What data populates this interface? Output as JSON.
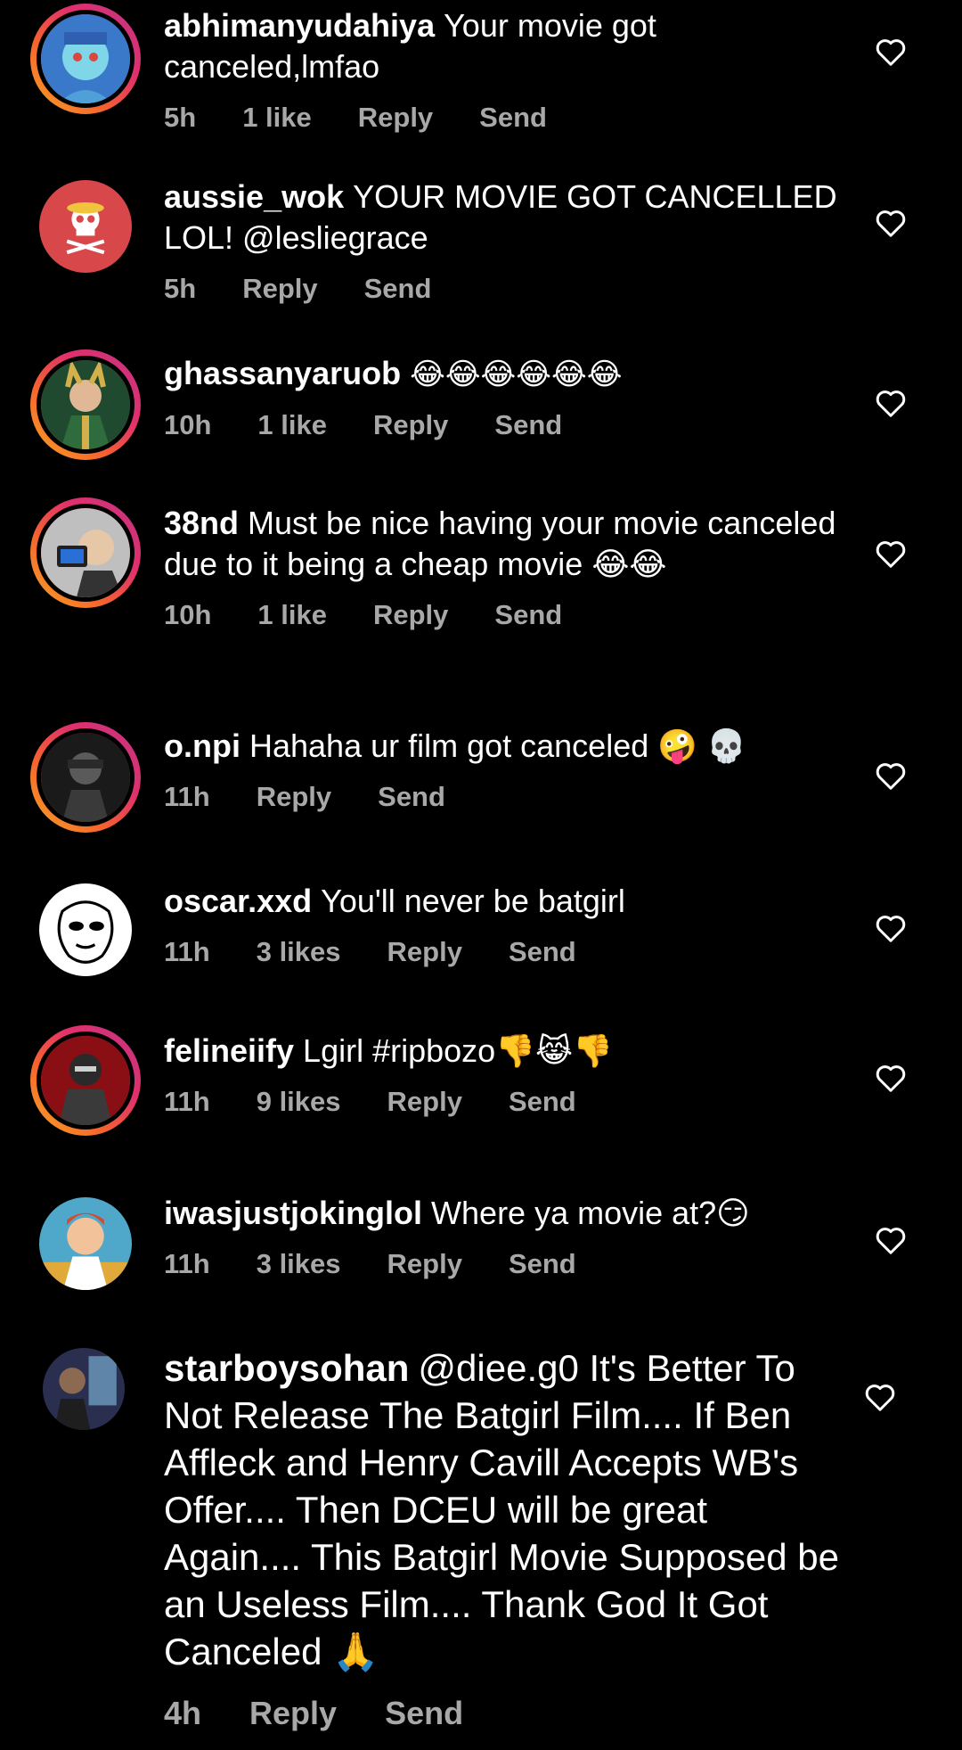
{
  "colors": {
    "background": "#000000",
    "text": "#ffffff",
    "muted": "#a8a8a8",
    "story_ring": [
      "#f9a825",
      "#e1306c",
      "#c13584"
    ]
  },
  "icons": {
    "like": "heart-outline-icon"
  },
  "comments": [
    {
      "username": "abhimanyudahiya",
      "text": "Your movie got canceled,lmfao",
      "time": "5h",
      "likes": "1 like",
      "reply": "Reply",
      "send": "Send"
    },
    {
      "username": "aussie_wok",
      "text": "YOUR MOVIE GOT CANCELLED LOL! @lesliegrace",
      "time": "5h",
      "likes": "",
      "reply": "Reply",
      "send": "Send"
    },
    {
      "username": "ghassanyaruob",
      "text": "😂😂😂😂😂😂",
      "time": "10h",
      "likes": "1 like",
      "reply": "Reply",
      "send": "Send"
    },
    {
      "username": "38nd",
      "text": "Must be nice having your movie canceled due to it being a cheap movie 😂😂",
      "time": "10h",
      "likes": "1 like",
      "reply": "Reply",
      "send": "Send"
    },
    {
      "username": "o.npi",
      "text": "Hahaha ur film got canceled 🤪 💀",
      "time": "11h",
      "likes": "",
      "reply": "Reply",
      "send": "Send"
    },
    {
      "username": "oscar.xxd",
      "text": "You'll never be batgirl",
      "time": "11h",
      "likes": "3 likes",
      "reply": "Reply",
      "send": "Send"
    },
    {
      "username": "felineiify",
      "text": "Lgirl #ripbozo👎😹👎",
      "time": "11h",
      "likes": "9 likes",
      "reply": "Reply",
      "send": "Send"
    },
    {
      "username": "iwasjustjokinglol",
      "text": "Where ya movie at?😏",
      "time": "11h",
      "likes": "3 likes",
      "reply": "Reply",
      "send": "Send"
    },
    {
      "username": "starboysohan",
      "text": "@diee.g0 It's Better To Not Release The Batgirl Film.... If Ben Affleck and Henry Cavill Accepts WB's Offer.... Then DCEU will be great Again.... This Batgirl Movie Supposed be an Useless Film.... Thank God It Got Canceled 🙏",
      "time": "4h",
      "likes": "",
      "reply": "Reply",
      "send": "Send"
    }
  ]
}
